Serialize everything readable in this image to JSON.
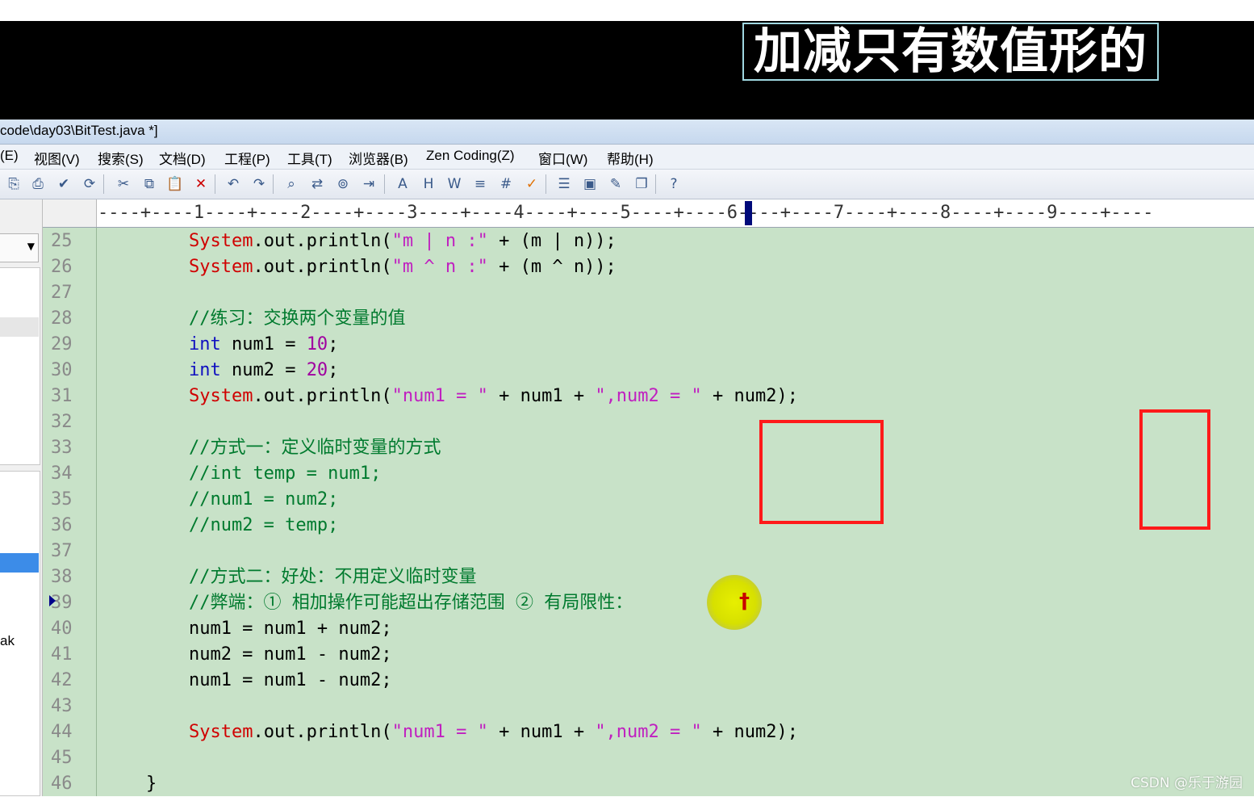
{
  "video_caption": "加减只有数值形的",
  "window": {
    "title": "code\\day03\\BitTest.java *]"
  },
  "menu": [
    "(E)",
    "视图(V)",
    "搜索(S)",
    "文档(D)",
    "工程(P)",
    "工具(T)",
    "浏览器(B)",
    "Zen Coding(Z)",
    "窗口(W)",
    "帮助(H)"
  ],
  "toolbar_icons": [
    "new-icon",
    "print-icon",
    "spellcheck-icon",
    "refresh-icon",
    "cut-icon",
    "copy-icon",
    "paste-icon",
    "delete-icon",
    "undo-icon",
    "redo-icon",
    "find-icon",
    "replace-icon",
    "find-in-files-icon",
    "indent-icon",
    "font-icon",
    "hex-icon",
    "wordwrap-icon",
    "column-mode-icon",
    "line-numbers-icon",
    "check-icon",
    "list-icon",
    "toggle-view-icon",
    "editor-icon",
    "window-icon",
    "help-icon"
  ],
  "ruler": "----+----1----+----2----+----3----+----4----+----5----+----6----+----7----+----8----+----9----+----",
  "left_panel": {
    "partial_text": "ak"
  },
  "code_lines": [
    {
      "n": "25",
      "parts": [
        {
          "t": "        "
        },
        {
          "t": "System",
          "c": "kw-red"
        },
        {
          "t": ".out.println("
        },
        {
          "t": "\"m | n :\"",
          "c": "str"
        },
        {
          "t": " + (m | n));"
        }
      ]
    },
    {
      "n": "26",
      "parts": [
        {
          "t": "        "
        },
        {
          "t": "System",
          "c": "kw-red"
        },
        {
          "t": ".out.println("
        },
        {
          "t": "\"m ^ n :\"",
          "c": "str"
        },
        {
          "t": " + (m ^ n));"
        }
      ]
    },
    {
      "n": "27",
      "parts": []
    },
    {
      "n": "28",
      "parts": [
        {
          "t": "        "
        },
        {
          "t": "//练习：交换两个变量的值",
          "c": "cm"
        }
      ]
    },
    {
      "n": "29",
      "parts": [
        {
          "t": "        "
        },
        {
          "t": "int",
          "c": "kw-blue"
        },
        {
          "t": " num1 = "
        },
        {
          "t": "10",
          "c": "num"
        },
        {
          "t": ";"
        }
      ]
    },
    {
      "n": "30",
      "parts": [
        {
          "t": "        "
        },
        {
          "t": "int",
          "c": "kw-blue"
        },
        {
          "t": " num2 = "
        },
        {
          "t": "20",
          "c": "num"
        },
        {
          "t": ";"
        }
      ]
    },
    {
      "n": "31",
      "parts": [
        {
          "t": "        "
        },
        {
          "t": "System",
          "c": "kw-red"
        },
        {
          "t": ".out.println("
        },
        {
          "t": "\"num1 = \"",
          "c": "str"
        },
        {
          "t": " + num1 + "
        },
        {
          "t": "\",num2 = \"",
          "c": "str"
        },
        {
          "t": " + num2);"
        }
      ]
    },
    {
      "n": "32",
      "parts": []
    },
    {
      "n": "33",
      "parts": [
        {
          "t": "        "
        },
        {
          "t": "//方式一：定义临时变量的方式",
          "c": "cm"
        }
      ]
    },
    {
      "n": "34",
      "parts": [
        {
          "t": "        "
        },
        {
          "t": "//int temp = num1;",
          "c": "cm"
        }
      ]
    },
    {
      "n": "35",
      "parts": [
        {
          "t": "        "
        },
        {
          "t": "//num1 = num2;",
          "c": "cm"
        }
      ]
    },
    {
      "n": "36",
      "parts": [
        {
          "t": "        "
        },
        {
          "t": "//num2 = temp;",
          "c": "cm"
        }
      ]
    },
    {
      "n": "37",
      "parts": []
    },
    {
      "n": "38",
      "parts": [
        {
          "t": "        "
        },
        {
          "t": "//方式二：好处：不用定义临时变量",
          "c": "cm"
        }
      ]
    },
    {
      "n": "39",
      "parts": [
        {
          "t": "        "
        },
        {
          "t": "//弊端：① 相加操作可能超出存储范围 ② 有局限性：",
          "c": "cm"
        }
      ]
    },
    {
      "n": "40",
      "parts": [
        {
          "t": "        num1 = num1 + num2;"
        }
      ]
    },
    {
      "n": "41",
      "parts": [
        {
          "t": "        num2 = num1 - num2;"
        }
      ]
    },
    {
      "n": "42",
      "parts": [
        {
          "t": "        num1 = num1 - num2;"
        }
      ]
    },
    {
      "n": "43",
      "parts": []
    },
    {
      "n": "44",
      "parts": [
        {
          "t": "        "
        },
        {
          "t": "System",
          "c": "kw-red"
        },
        {
          "t": ".out.println("
        },
        {
          "t": "\"num1 = \"",
          "c": "str"
        },
        {
          "t": " + num1 + "
        },
        {
          "t": "\",num2 = \"",
          "c": "str"
        },
        {
          "t": " + num2);"
        }
      ]
    },
    {
      "n": "45",
      "parts": []
    },
    {
      "n": "46",
      "parts": [
        {
          "t": "    }"
        }
      ]
    }
  ],
  "cursor_glyph": "†",
  "watermark": "CSDN @乐于游园",
  "colors": {
    "editor_bg": "#c8e2c8",
    "keyword_red": "#d00000",
    "keyword_blue": "#1010c0",
    "string": "#c020c0",
    "comment": "#007a2e",
    "annotation": "#ff1a1a"
  }
}
